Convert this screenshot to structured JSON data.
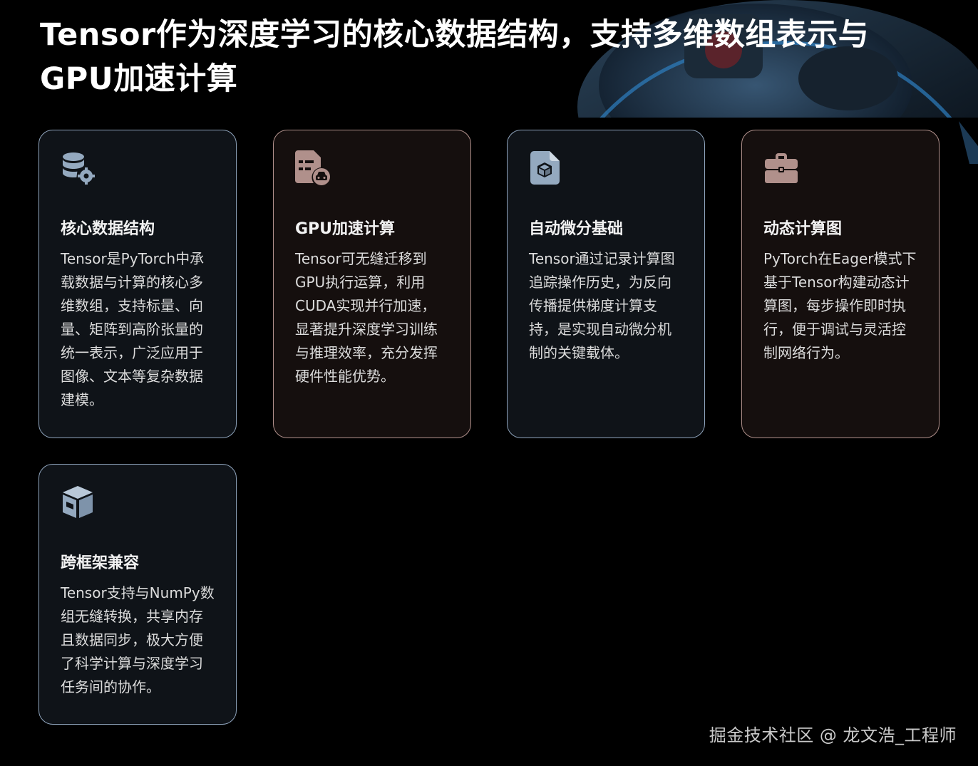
{
  "title": "Tensor作为深度学习的核心数据结构，支持多维数组表示与GPU加速计算",
  "cards": [
    {
      "icon": "database-gear-icon",
      "heading": "核心数据结构",
      "text": "Tensor是PyTorch中承载数据与计算的核心多维数组，支持标量、向量、矩阵到高阶张量的统一表示，广泛应用于图像、文本等复杂数据建模。",
      "accent": "#8ea3bb"
    },
    {
      "icon": "file-car-icon",
      "heading": "GPU加速计算",
      "text": "Tensor可无缝迁移到GPU执行运算，利用CUDA实现并行加速，显著提升深度学习训练与推理效率，充分发挥硬件性能优势。",
      "accent": "#b0908b"
    },
    {
      "icon": "file-cube-icon",
      "heading": "自动微分基础",
      "text": "Tensor通过记录计算图追踪操作历史，为反向传播提供梯度计算支持，是实现自动微分机制的关键载体。",
      "accent": "#8ea3bb"
    },
    {
      "icon": "toolbox-icon",
      "heading": "动态计算图",
      "text": "PyTorch在Eager模式下基于Tensor构建动态计算图，每步操作即时执行，便于调试与灵活控制网络行为。",
      "accent": "#b0908b"
    },
    {
      "icon": "box-icon",
      "heading": "跨框架兼容",
      "text": "Tensor支持与NumPy数组无缝转换，共享内存且数据同步，极大方便了科学计算与深度学习任务间的协作。",
      "accent": "#8ea3bb"
    }
  ],
  "watermark": "掘金技术社区 @ 龙文浩_工程师"
}
